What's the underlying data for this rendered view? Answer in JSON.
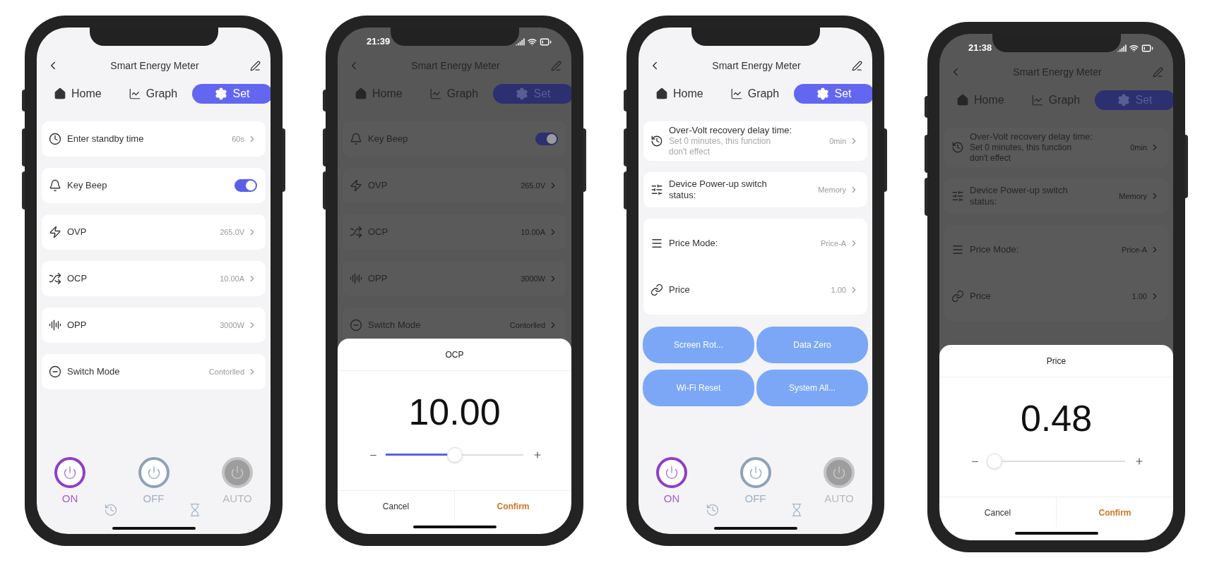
{
  "screens": [
    {
      "dimmed": false,
      "header": {
        "title": "Smart Energy Meter"
      },
      "tabs": [
        {
          "label": "Home",
          "selected": false
        },
        {
          "label": "Graph",
          "selected": false
        },
        {
          "label": "Set",
          "selected": true
        }
      ],
      "cards": [
        [
          {
            "kind": "value",
            "label": "Enter standby time",
            "value": "60s"
          }
        ],
        [
          {
            "kind": "toggle",
            "label": "Key Beep",
            "on": true
          }
        ],
        [
          {
            "kind": "value",
            "label": "OVP",
            "value": "265.0V"
          }
        ],
        [
          {
            "kind": "value",
            "label": "OCP",
            "value": "10.00A"
          }
        ],
        [
          {
            "kind": "value",
            "label": "OPP",
            "value": "3000W"
          }
        ],
        [
          {
            "kind": "value",
            "label": "Switch Mode",
            "value": "Contorlled"
          }
        ]
      ],
      "power_buttons": [
        {
          "kind": "on",
          "label": "ON"
        },
        {
          "kind": "off",
          "label": "OFF"
        },
        {
          "kind": "auto",
          "label": "AUTO"
        }
      ]
    },
    {
      "status_bar": {
        "time": "21:39"
      },
      "dimmed": true,
      "header": {
        "title": "Smart Energy Meter"
      },
      "tabs": [
        {
          "label": "Home",
          "selected": false
        },
        {
          "label": "Graph",
          "selected": false
        },
        {
          "label": "Set",
          "selected": true
        }
      ],
      "cards": [
        [
          {
            "kind": "toggle",
            "label": "Key Beep",
            "on": true
          }
        ],
        [
          {
            "kind": "value",
            "label": "OVP",
            "value": "265.0V"
          }
        ],
        [
          {
            "kind": "value",
            "label": "OCP",
            "value": "10.00A"
          }
        ],
        [
          {
            "kind": "value",
            "label": "OPP",
            "value": "3000W"
          }
        ],
        [
          {
            "kind": "value",
            "label": "Switch Mode",
            "value": "Contorlled"
          }
        ]
      ],
      "sheet": {
        "title": "OCP",
        "value": "10.00",
        "level": 0.5,
        "cancel": "Cancel",
        "confirm": "Confirm"
      }
    },
    {
      "dimmed": false,
      "header": {
        "title": "Smart Energy Meter"
      },
      "tabs": [
        {
          "label": "Home",
          "selected": false
        },
        {
          "label": "Graph",
          "selected": false
        },
        {
          "label": "Set",
          "selected": true
        }
      ],
      "cards": [
        [
          {
            "kind": "note",
            "label": "Over-Volt recovery delay time:",
            "note": "Set 0 minutes, this function don't effect",
            "value": "0min"
          }
        ],
        [
          {
            "kind": "value",
            "label": "Device Power-up switch status:",
            "value": "Memory"
          }
        ],
        [
          {
            "kind": "value",
            "label": "Price Mode:",
            "value": "Price-A"
          },
          {
            "kind": "value",
            "label": "Price",
            "value": "1.00"
          }
        ]
      ],
      "actions": [
        "Screen Rot...",
        "Data Zero",
        "Wi-Fi Reset",
        "System All..."
      ],
      "power_buttons": [
        {
          "kind": "on",
          "label": "ON"
        },
        {
          "kind": "off",
          "label": "OFF"
        },
        {
          "kind": "auto",
          "label": "AUTO"
        }
      ]
    },
    {
      "status_bar": {
        "time": "21:38"
      },
      "dimmed": true,
      "header": {
        "title": "Smart Energy Meter"
      },
      "tabs": [
        {
          "label": "Home",
          "selected": false
        },
        {
          "label": "Graph",
          "selected": false
        },
        {
          "label": "Set",
          "selected": true
        }
      ],
      "cards": [
        [
          {
            "kind": "note",
            "label": "Over-Volt recovery delay time:",
            "note": "Set 0 minutes, this function don't effect",
            "value": "0min"
          }
        ],
        [
          {
            "kind": "value",
            "label": "Device Power-up switch status:",
            "value": "Memory"
          }
        ],
        [
          {
            "kind": "value",
            "label": "Price Mode:",
            "value": "Price-A"
          },
          {
            "kind": "value",
            "label": "Price",
            "value": "1.00"
          }
        ]
      ],
      "sheet": {
        "title": "Price",
        "value": "0.48",
        "level": 0.05,
        "cancel": "Cancel",
        "confirm": "Confirm"
      }
    }
  ]
}
